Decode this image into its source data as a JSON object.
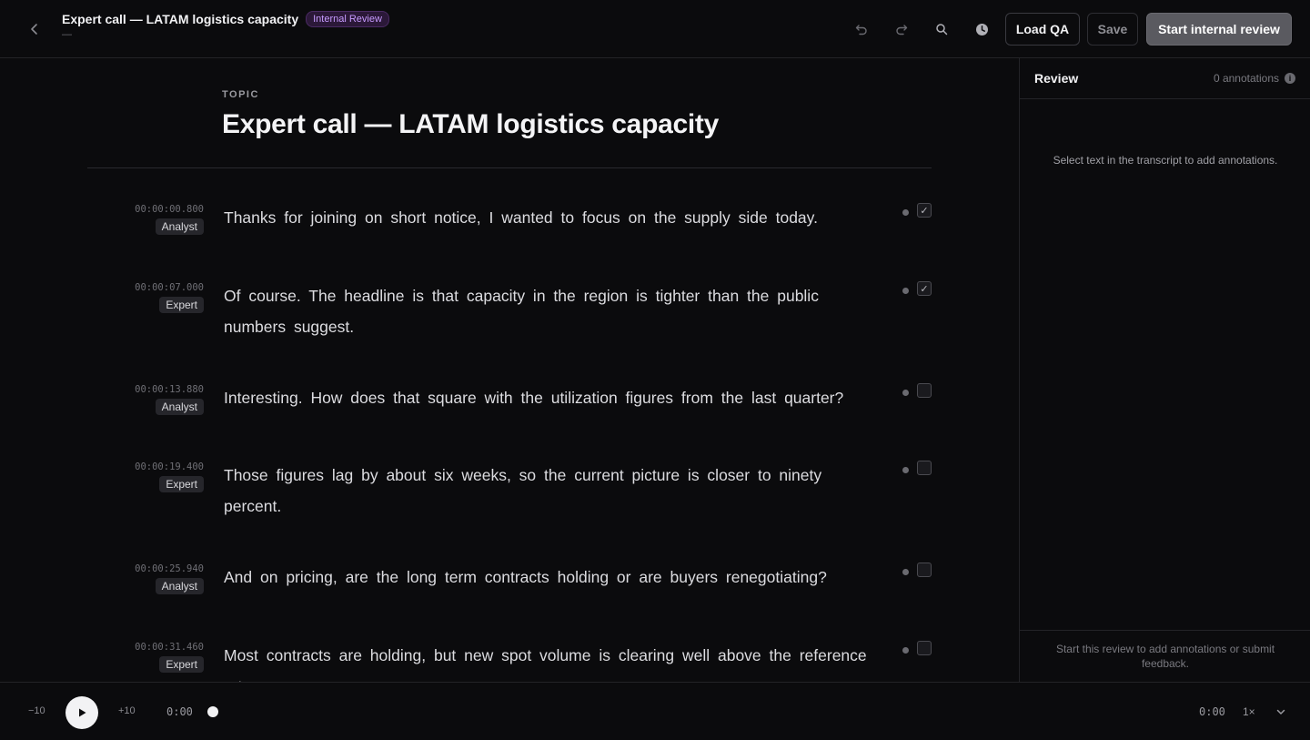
{
  "header": {
    "title": "Expert call — LATAM logistics capacity",
    "status_badge": "Internal Review",
    "subtitle": "—",
    "load_qa_label": "Load QA",
    "save_label": "Save",
    "start_review_label": "Start internal review"
  },
  "main": {
    "topic_label": "TOPIC",
    "topic_title": "Expert call — LATAM logistics capacity",
    "segments": [
      {
        "timestamp": "00:00:00.800",
        "speaker": "Analyst",
        "text": "Thanks for joining on short notice, I wanted to focus on the supply side today.",
        "checked": true
      },
      {
        "timestamp": "00:00:07.000",
        "speaker": "Expert",
        "text": "Of course. The headline is that capacity in the region is tighter than the public numbers suggest.",
        "checked": true
      },
      {
        "timestamp": "00:00:13.880",
        "speaker": "Analyst",
        "text": "Interesting. How does that square with the utilization figures from the last quarter?",
        "checked": false
      },
      {
        "timestamp": "00:00:19.400",
        "speaker": "Expert",
        "text": "Those figures lag by about six weeks, so the current picture is closer to ninety percent.",
        "checked": false
      },
      {
        "timestamp": "00:00:25.940",
        "speaker": "Analyst",
        "text": "And on pricing, are the long term contracts holding or are buyers renegotiating?",
        "checked": false
      },
      {
        "timestamp": "00:00:31.460",
        "speaker": "Expert",
        "text": "Most contracts are holding, but new spot volume is clearing well above the reference rates.",
        "checked": false
      }
    ]
  },
  "review": {
    "title": "Review",
    "annotation_count": "0 annotations",
    "empty_message": "Select text in the transcript to add annotations.",
    "footer_message": "Start this review to add annotations or submit feedback."
  },
  "player": {
    "skip_back": "−10",
    "skip_forward": "+10",
    "current_time": "0:00",
    "duration": "0:00",
    "playback_rate": "1×"
  },
  "colors": {
    "background": "#0b0b0d",
    "badge_text": "#c79bff",
    "badge_bg": "#2b1838",
    "primary_button": "#5a5a60"
  }
}
